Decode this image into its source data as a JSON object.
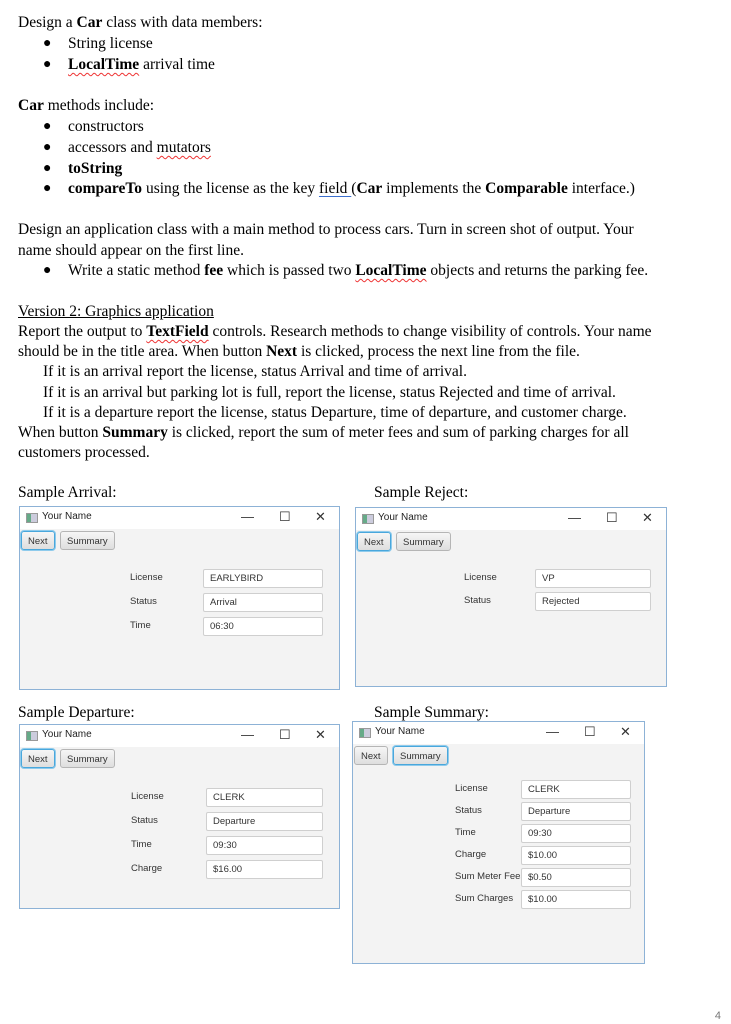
{
  "doc": {
    "intro": {
      "pre": "Design a ",
      "bold": "Car",
      "post": " class with data members:"
    },
    "members": [
      {
        "text": "String license"
      },
      {
        "bold": "LocalTime",
        "post": " arrival time"
      }
    ],
    "methods_heading": {
      "bold": "Car",
      "post": " methods include:"
    },
    "methods": [
      {
        "text": "constructors"
      },
      {
        "pre": "accessors and ",
        "squiggle": "mutators"
      },
      {
        "bold": "toString"
      },
      {
        "bold": "compareTo",
        "mid": " using the license as the key ",
        "link": "field ",
        "mid2": " (",
        "bold2": "Car",
        "mid3": " implements the ",
        "bold3": "Comparable",
        "post": " interface.)"
      }
    ],
    "app_para_line1": "Design an application class with a main method to process cars. Turn in screen shot of output.  Your",
    "app_para_line2": "name should appear on the first line.",
    "fee_bullet": {
      "pre": "Write a static method ",
      "bold": "fee",
      "mid": " which is passed two ",
      "bold2": "LocalTime",
      "post": " objects and returns the parking fee."
    },
    "version_heading": "Version 2:  Graphics application",
    "v2_line1": {
      "pre": "Report the output to ",
      "bold": "TextField",
      "post": " controls.  Research methods to change visibility of controls.  Your name"
    },
    "v2_line2": {
      "pre": "should be in the title area. When button ",
      "bold": "Next",
      "post": " is clicked, process the next line from the file."
    },
    "v2_cases": [
      "If it is an arrival report the license, status Arrival and time of arrival.",
      "If it is an arrival but parking lot is full, report the license, status Rejected and time of arrival.",
      "If it is a departure report the license, status Departure, time of departure, and customer charge."
    ],
    "v2_summary_line1": {
      "pre": "When button ",
      "bold": "Summary",
      "post": " is clicked, report the sum of meter fees and sum of parking charges for all"
    },
    "v2_summary_line2": "customers processed.",
    "page_number": "4"
  },
  "samples": [
    {
      "caption": "Sample Arrival:",
      "window_title": "Your Name",
      "focused": "next",
      "fields": [
        {
          "label": "License",
          "value": "EARLYBIRD"
        },
        {
          "label": "Status",
          "value": "Arrival"
        },
        {
          "label": "Time",
          "value": "06:30"
        }
      ]
    },
    {
      "caption": "Sample Reject:",
      "window_title": "Your Name",
      "focused": "next",
      "fields": [
        {
          "label": "License",
          "value": "VP"
        },
        {
          "label": "Status",
          "value": "Rejected"
        }
      ]
    },
    {
      "caption": "Sample Departure:",
      "window_title": "Your Name",
      "focused": "next",
      "fields": [
        {
          "label": "License",
          "value": "CLERK"
        },
        {
          "label": "Status",
          "value": "Departure"
        },
        {
          "label": "Time",
          "value": "09:30"
        },
        {
          "label": "Charge",
          "value": "$16.00"
        }
      ]
    },
    {
      "caption": "Sample Summary:",
      "window_title": "Your Name",
      "focused": "summary",
      "fields": [
        {
          "label": "License",
          "value": "CLERK"
        },
        {
          "label": "Status",
          "value": "Departure"
        },
        {
          "label": "Time",
          "value": "09:30"
        },
        {
          "label": "Charge",
          "value": "$10.00"
        },
        {
          "label": "Sum Meter Fees",
          "value": "$0.50"
        },
        {
          "label": "Sum Charges",
          "value": "$10.00"
        }
      ]
    }
  ],
  "buttons": {
    "next": "Next",
    "summary": "Summary"
  },
  "window_controls": {
    "minimize": "—",
    "maximize": "☐",
    "close": "✕"
  }
}
